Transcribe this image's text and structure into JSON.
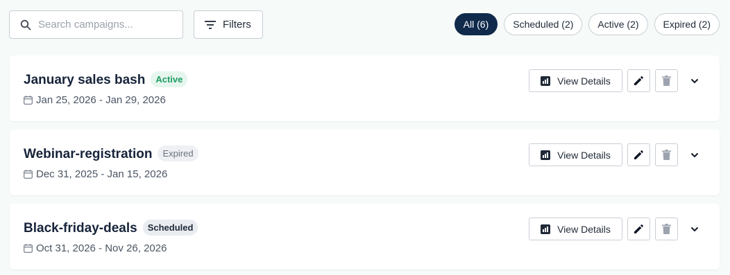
{
  "search": {
    "placeholder": "Search campaigns..."
  },
  "filters": {
    "label": "Filters"
  },
  "chips": [
    {
      "label": "All (6)",
      "selected": true
    },
    {
      "label": "Scheduled (2)",
      "selected": false
    },
    {
      "label": "Active (2)",
      "selected": false
    },
    {
      "label": "Expired (2)",
      "selected": false
    }
  ],
  "campaigns": [
    {
      "name": "January sales bash",
      "status": "Active",
      "dates": "Jan 25, 2026 - Jan 29, 2026"
    },
    {
      "name": "Webinar-registration",
      "status": "Expired",
      "dates": "Dec 31, 2025 - Jan 15, 2026"
    },
    {
      "name": "Black-friday-deals",
      "status": "Scheduled",
      "dates": "Oct 31, 2026 - Nov 26, 2026"
    }
  ],
  "actions": {
    "view_details_label": "View Details"
  },
  "icons": {
    "search": "search-icon",
    "filter": "filter-icon",
    "calendar": "calendar-icon",
    "chart": "bar-chart-icon",
    "edit": "pencil-icon",
    "delete": "trash-icon",
    "expand": "chevron-down-icon"
  },
  "colors": {
    "accent": "#102a4c",
    "active": "#1f9d62",
    "background": "#f6faf8"
  }
}
